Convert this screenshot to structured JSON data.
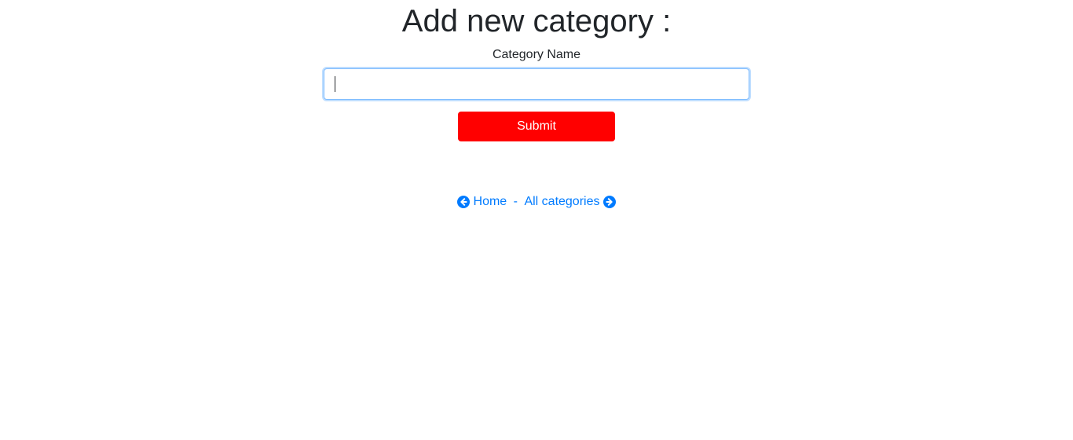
{
  "page": {
    "title": "Add new category :"
  },
  "form": {
    "category_label": "Category Name",
    "category_value": "",
    "submit_label": "Submit"
  },
  "nav": {
    "home_label": "Home",
    "separator": "-",
    "all_categories_label": "All categories",
    "home_icon": "arrow-circle-left-icon",
    "all_categories_icon": "arrow-circle-right-icon"
  },
  "colors": {
    "submit_bg": "#ff0000",
    "link": "#007bff",
    "input_focus_border": "#80bdff"
  }
}
